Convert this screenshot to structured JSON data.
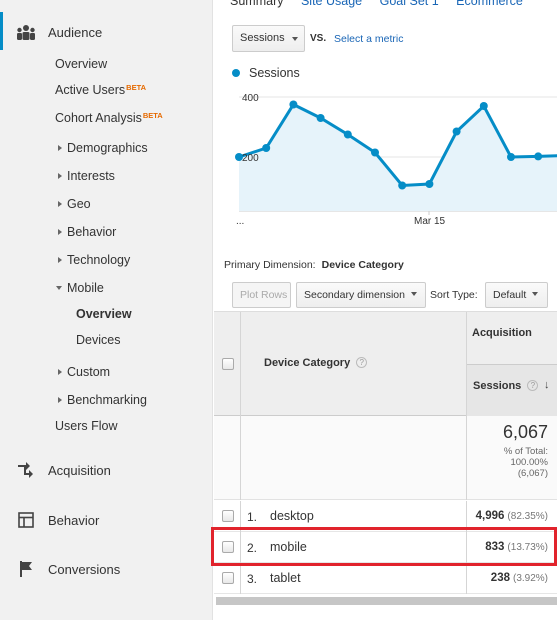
{
  "sidebar": {
    "audience": {
      "label": "Audience"
    },
    "items": [
      {
        "label": "Overview"
      },
      {
        "label": "Active Users",
        "badge": "BETA"
      },
      {
        "label": "Cohort Analysis",
        "badge": "BETA"
      },
      {
        "label": "Demographics"
      },
      {
        "label": "Interests"
      },
      {
        "label": "Geo"
      },
      {
        "label": "Behavior"
      },
      {
        "label": "Technology"
      },
      {
        "label": "Mobile"
      }
    ],
    "mobile_sub": [
      {
        "label": "Overview"
      },
      {
        "label": "Devices"
      }
    ],
    "after_items": [
      {
        "label": "Custom"
      },
      {
        "label": "Benchmarking"
      },
      {
        "label": "Users Flow"
      }
    ],
    "sections": [
      {
        "label": "Acquisition",
        "icon": "acquisition-icon"
      },
      {
        "label": "Behavior",
        "icon": "behavior-icon"
      },
      {
        "label": "Conversions",
        "icon": "flag-icon"
      }
    ]
  },
  "tabs": [
    "Summary",
    "Site Usage",
    "Goal Set 1",
    "Ecommerce"
  ],
  "metric_picker": {
    "value": "Sessions",
    "vs": "VS.",
    "select_metric": "Select a metric"
  },
  "chart_data": {
    "type": "line",
    "series": [
      {
        "name": "Sessions",
        "values": [
          200,
          230,
          375,
          330,
          275,
          215,
          105,
          110,
          285,
          370,
          200,
          202,
          205
        ]
      }
    ],
    "y_ticks": [
      "400",
      "200"
    ],
    "x_labels": [
      "...",
      "Mar 15"
    ],
    "ylim": [
      0,
      440
    ],
    "color": "#058dc7"
  },
  "primary_dimension": {
    "label": "Primary Dimension:",
    "value": "Device Category"
  },
  "toolbar": {
    "plot_rows": "Plot Rows",
    "secondary_dimension": "Secondary dimension",
    "sort_type_label": "Sort Type:",
    "sort_type_value": "Default"
  },
  "table": {
    "group_header": "Acquisition",
    "dim_header": "Device Category",
    "metric_header": "Sessions",
    "help": "?",
    "sort_arrow": "↓",
    "total": {
      "value": "6,067",
      "line1": "% of Total:",
      "line2": "100.00%",
      "line3": "(6,067)"
    },
    "rows": [
      {
        "num": "1.",
        "dim": "desktop",
        "sessions": "4,996",
        "pct": "(82.35%)"
      },
      {
        "num": "2.",
        "dim": "mobile",
        "sessions": "833",
        "pct": "(13.73%)"
      },
      {
        "num": "3.",
        "dim": "tablet",
        "sessions": "238",
        "pct": "(3.92%)"
      }
    ]
  }
}
